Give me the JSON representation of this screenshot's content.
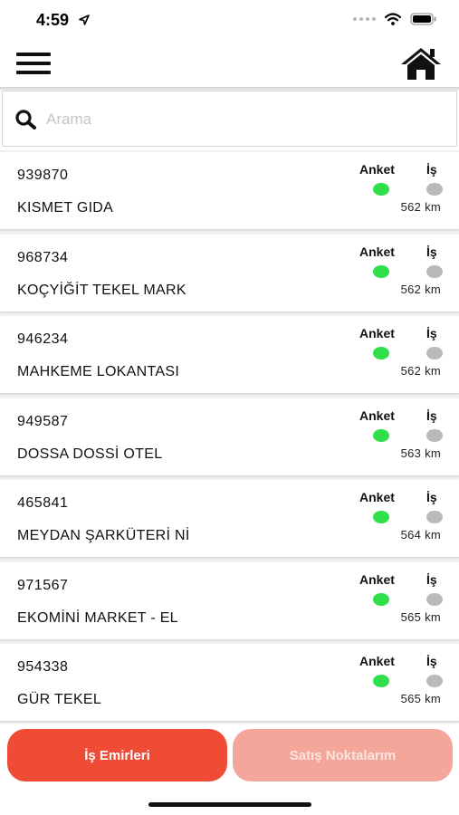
{
  "status_bar": {
    "time": "4:59",
    "location_icon": "location-arrow-icon",
    "wifi_icon": "wifi-icon",
    "battery_icon": "battery-icon"
  },
  "header": {
    "menu_icon": "hamburger-menu-icon",
    "home_icon": "home-icon"
  },
  "search": {
    "placeholder": "Arama",
    "value": "",
    "icon": "search-icon"
  },
  "list": {
    "col_survey_label": "Anket",
    "col_job_label": "İş",
    "items": [
      {
        "code": "939870",
        "name": "KISMET GIDA",
        "distance": "562 km",
        "survey_status": "green",
        "job_status": "gray"
      },
      {
        "code": "968734",
        "name": "KOÇYİĞİT TEKEL MARK",
        "distance": "562 km",
        "survey_status": "green",
        "job_status": "gray"
      },
      {
        "code": "946234",
        "name": "MAHKEME LOKANTASI",
        "distance": "562 km",
        "survey_status": "green",
        "job_status": "gray"
      },
      {
        "code": "949587",
        "name": "DOSSA DOSSİ OTEL",
        "distance": "563 km",
        "survey_status": "green",
        "job_status": "gray"
      },
      {
        "code": "465841",
        "name": "MEYDAN ŞARKÜTERİ Nİ",
        "distance": "564 km",
        "survey_status": "green",
        "job_status": "gray"
      },
      {
        "code": "971567",
        "name": "EKOMİNİ MARKET - EL",
        "distance": "565 km",
        "survey_status": "green",
        "job_status": "gray"
      },
      {
        "code": "954338",
        "name": "GÜR TEKEL",
        "distance": "565 km",
        "survey_status": "green",
        "job_status": "gray"
      }
    ]
  },
  "tabs": {
    "jobs_label": "İş Emirleri",
    "sales_label": "Satış Noktalarım"
  },
  "colors": {
    "status_green": "#2fe04a",
    "status_gray": "#b9b9b9",
    "primary_red": "#f04c35",
    "light_red": "#f5a69b"
  }
}
